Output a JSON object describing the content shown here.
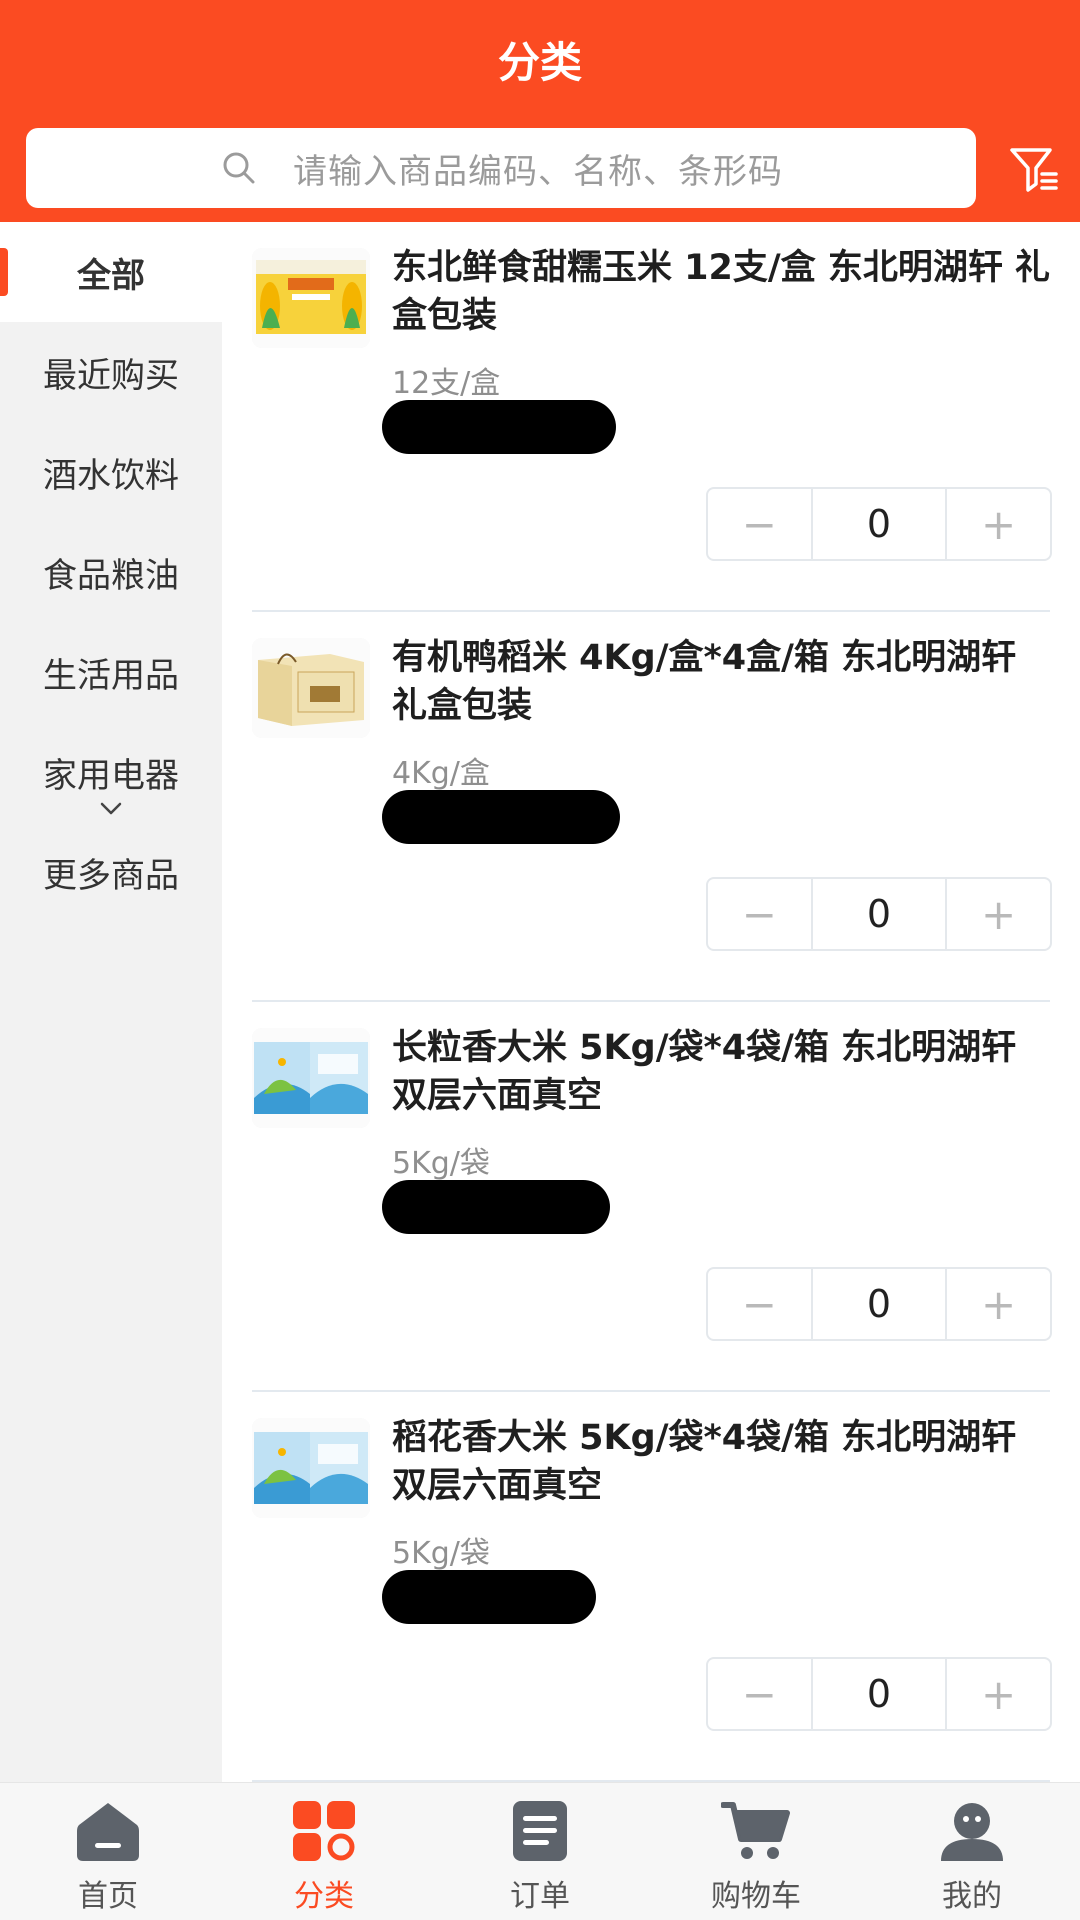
{
  "header": {
    "title": "分类",
    "search_placeholder": "请输入商品编码、名称、条形码",
    "accent_color": "#fb4b22"
  },
  "sidebar": {
    "items": [
      {
        "label": "全部",
        "active": true
      },
      {
        "label": "最近购买",
        "active": false
      },
      {
        "label": "酒水饮料",
        "active": false
      },
      {
        "label": "食品粮油",
        "active": false
      },
      {
        "label": "生活用品",
        "active": false
      },
      {
        "label": "家用电器",
        "active": false
      },
      {
        "label": "更多商品",
        "active": false
      }
    ]
  },
  "products": [
    {
      "name": "东北鲜食甜糯玉米 12支/盒 东北明湖轩 礼盒包装",
      "spec": "12支/盒",
      "quantity": "0",
      "thumb_icon": "corn-box-image"
    },
    {
      "name": "有机鸭稻米 4Kg/盒*4盒/箱 东北明湖轩 礼盒包装",
      "spec": "4Kg/盒",
      "quantity": "0",
      "thumb_icon": "rice-gift-box-image"
    },
    {
      "name": "长粒香大米 5Kg/袋*4袋/箱 东北明湖轩 双层六面真空",
      "spec": "5Kg/袋",
      "quantity": "0",
      "thumb_icon": "rice-bag-image"
    },
    {
      "name": "稻花香大米 5Kg/袋*4袋/箱 东北明湖轩 双层六面真空",
      "spec": "5Kg/袋",
      "quantity": "0",
      "thumb_icon": "rice-bag-image"
    }
  ],
  "stepper": {
    "minus": "−",
    "plus": "+"
  },
  "bottom_nav": {
    "items": [
      {
        "label": "首页",
        "icon": "home-icon",
        "active": false
      },
      {
        "label": "分类",
        "icon": "category-icon",
        "active": true
      },
      {
        "label": "订单",
        "icon": "order-icon",
        "active": false
      },
      {
        "label": "购物车",
        "icon": "cart-icon",
        "active": false
      },
      {
        "label": "我的",
        "icon": "profile-icon",
        "active": false
      }
    ]
  }
}
